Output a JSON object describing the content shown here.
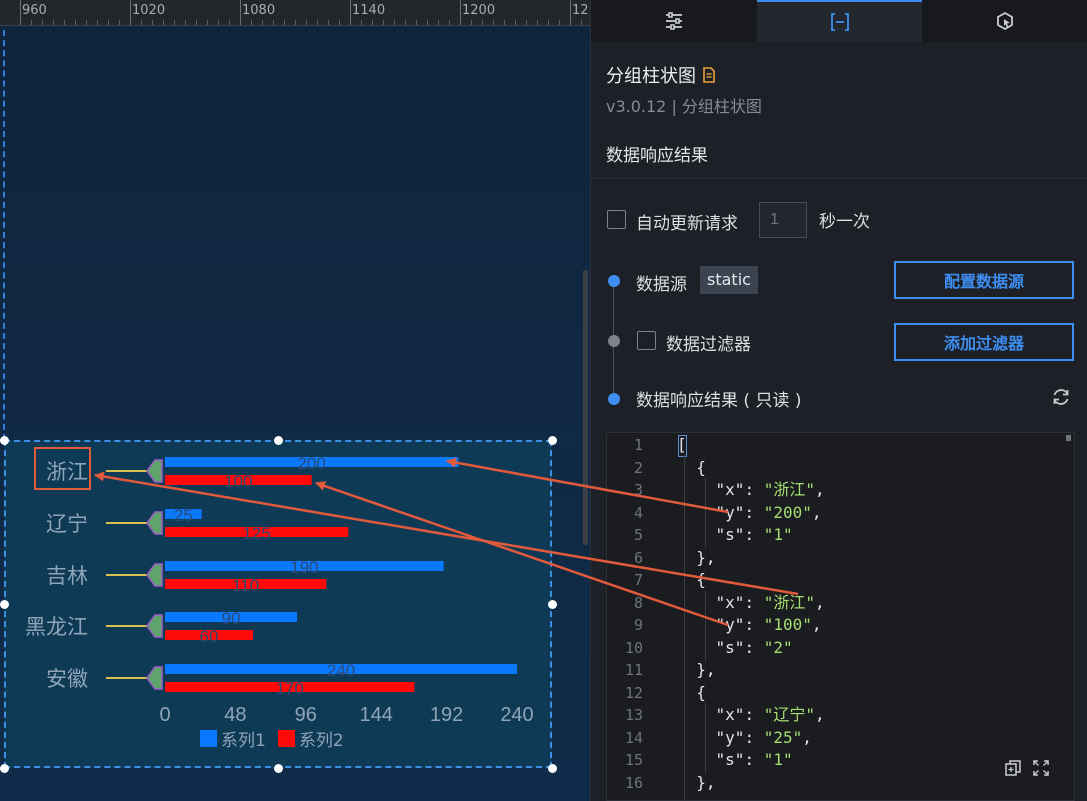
{
  "ruler": {
    "labels": [
      "960",
      "1020",
      "1080",
      "1140",
      "1200",
      "12"
    ]
  },
  "chart_data": {
    "type": "bar",
    "orientation": "horizontal",
    "categories": [
      "浙江",
      "辽宁",
      "吉林",
      "黑龙江",
      "安徽"
    ],
    "series": [
      {
        "name": "系列1",
        "color": "#0a78ff",
        "values": [
          200,
          25,
          190,
          90,
          240
        ]
      },
      {
        "name": "系列2",
        "color": "#ff0a0a",
        "values": [
          100,
          125,
          110,
          60,
          170
        ]
      }
    ],
    "xticks": [
      "0",
      "48",
      "96",
      "144",
      "192",
      "240"
    ],
    "xlim": [
      0,
      240
    ],
    "legend_position": "bottom",
    "grid": false
  },
  "panel": {
    "tabs": [
      {
        "icon": "sliders-icon"
      },
      {
        "icon": "data-bracket-icon",
        "active": true
      },
      {
        "icon": "interaction-icon"
      }
    ],
    "component_title": "分组柱状图",
    "component_version": "v3.0.12 | 分组柱状图",
    "section_title": "数据响应结果",
    "auto_update_label": "自动更新请求",
    "interval_value": "1",
    "interval_suffix": "秒一次",
    "datasource_label": "数据源",
    "datasource_type": "static",
    "configure_button": "配置数据源",
    "filter_label": "数据过滤器",
    "add_filter_button": "添加过滤器",
    "result_label": "数据响应结果 ( 只读 )",
    "colors": {
      "accent": "#3d8ef0",
      "string": "#a6de72"
    }
  },
  "editor": {
    "line_numbers": [
      "1",
      "2",
      "3",
      "4",
      "5",
      "6",
      "7",
      "8",
      "9",
      "10",
      "11",
      "12",
      "13",
      "14",
      "15",
      "16"
    ],
    "lines": [
      {
        "indent": "",
        "text": "["
      },
      {
        "indent": "  ",
        "text": "{"
      },
      {
        "indent": "    ",
        "key": "\"x\"",
        "value": "\"浙江\"",
        "trail": ","
      },
      {
        "indent": "    ",
        "key": "\"y\"",
        "value": "\"200\"",
        "trail": ","
      },
      {
        "indent": "    ",
        "key": "\"s\"",
        "value": "\"1\"",
        "trail": ""
      },
      {
        "indent": "  ",
        "text": "},"
      },
      {
        "indent": "  ",
        "text": "{"
      },
      {
        "indent": "    ",
        "key": "\"x\"",
        "value": "\"浙江\"",
        "trail": ","
      },
      {
        "indent": "    ",
        "key": "\"y\"",
        "value": "\"100\"",
        "trail": ","
      },
      {
        "indent": "    ",
        "key": "\"s\"",
        "value": "\"2\"",
        "trail": ""
      },
      {
        "indent": "  ",
        "text": "},"
      },
      {
        "indent": "  ",
        "text": "{"
      },
      {
        "indent": "    ",
        "key": "\"x\"",
        "value": "\"辽宁\"",
        "trail": ","
      },
      {
        "indent": "    ",
        "key": "\"y\"",
        "value": "\"25\"",
        "trail": ","
      },
      {
        "indent": "    ",
        "key": "\"s\"",
        "value": "\"1\"",
        "trail": ""
      },
      {
        "indent": "  ",
        "text": "},"
      }
    ]
  }
}
